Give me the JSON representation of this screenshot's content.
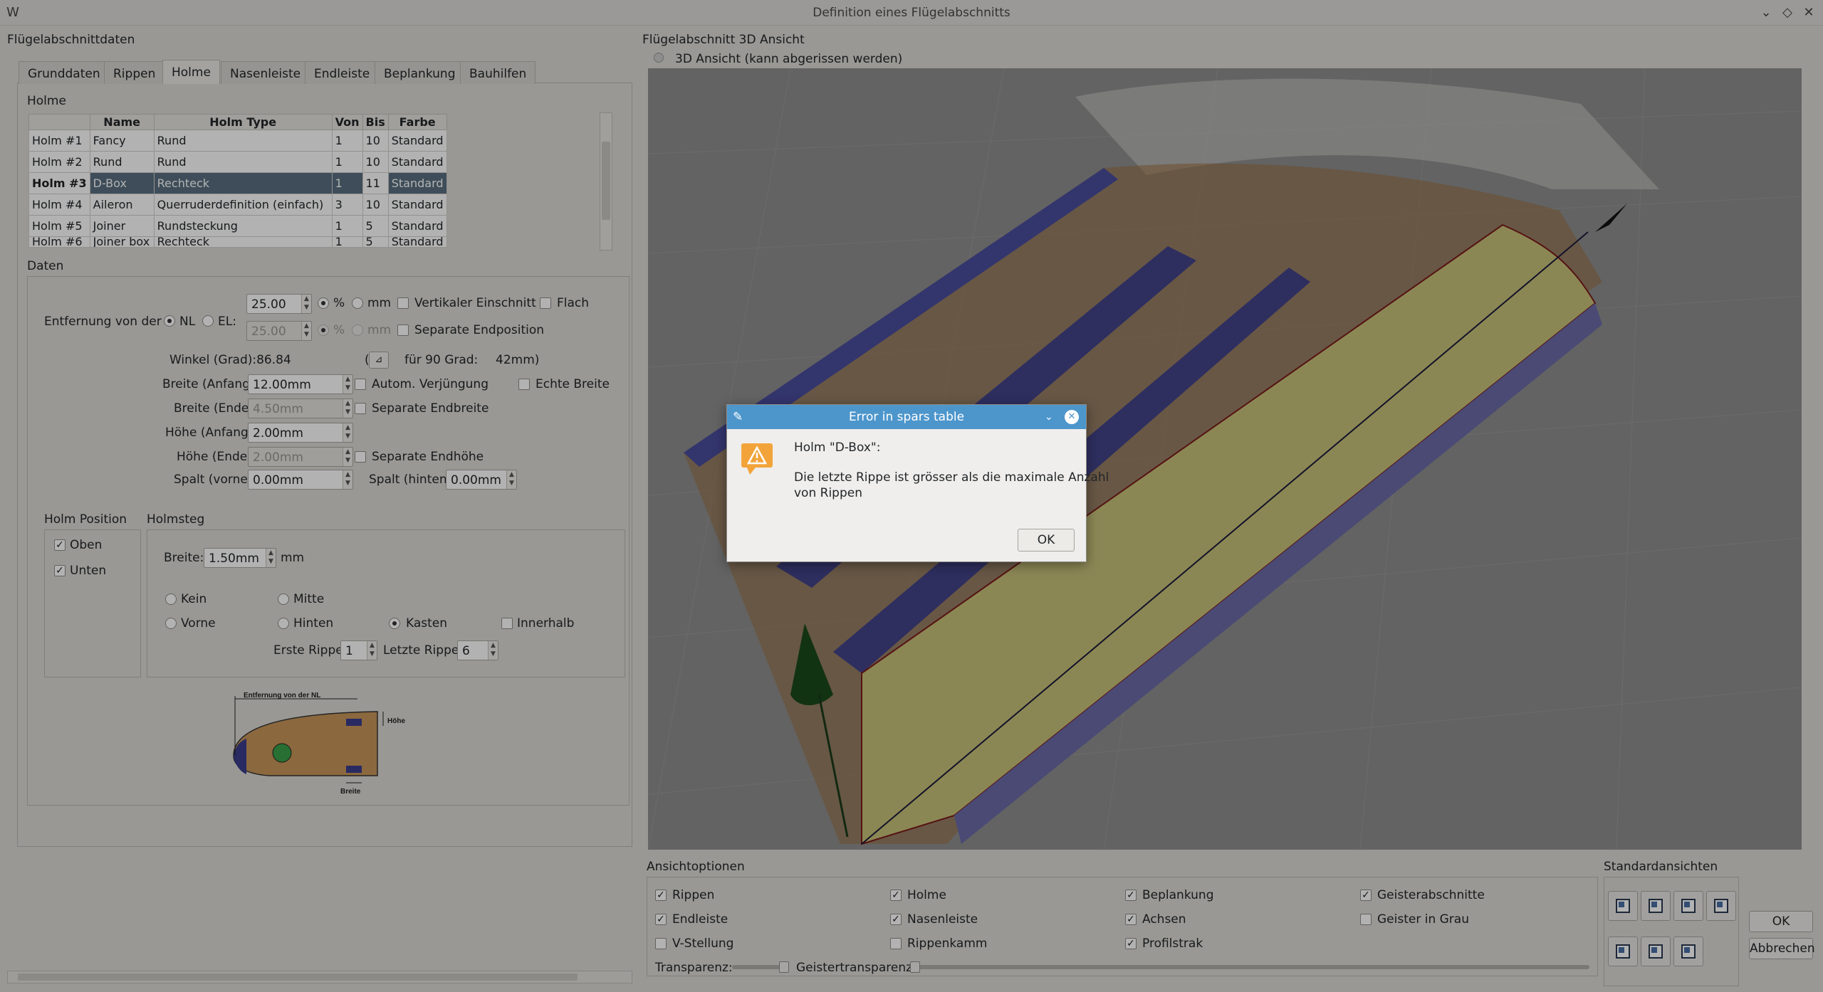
{
  "window": {
    "title": "Definition eines Flügelabschnitts"
  },
  "left_panel": {
    "title": "Flügelabschnittdaten"
  },
  "tabs": [
    {
      "label": "Grunddaten"
    },
    {
      "label": "Rippen"
    },
    {
      "label": "Holme"
    },
    {
      "label": "Nasenleiste"
    },
    {
      "label": "Endleiste"
    },
    {
      "label": "Beplankung"
    },
    {
      "label": "Bauhilfen"
    }
  ],
  "spars": {
    "group_title": "Holme",
    "columns": [
      "Name",
      "Holm Type",
      "Von",
      "Bis",
      "Farbe"
    ],
    "rows": [
      {
        "id": "Holm #1",
        "name": "Fancy",
        "type": "Rund",
        "von": "1",
        "bis": "10",
        "farbe": "Standard"
      },
      {
        "id": "Holm #2",
        "name": "Rund",
        "type": "Rund",
        "von": "1",
        "bis": "10",
        "farbe": "Standard"
      },
      {
        "id": "Holm #3",
        "name": "D-Box",
        "type": "Rechteck",
        "von": "1",
        "bis": "11",
        "farbe": "Standard"
      },
      {
        "id": "Holm #4",
        "name": "Aileron",
        "type": "Querruderdefinition (einfach)",
        "von": "3",
        "bis": "10",
        "farbe": "Standard"
      },
      {
        "id": "Holm #5",
        "name": "Joiner",
        "type": "Rundsteckung",
        "von": "1",
        "bis": "5",
        "farbe": "Standard"
      },
      {
        "id": "Holm #6",
        "name": "Joiner box",
        "type": "Rechteck",
        "von": "1",
        "bis": "5",
        "farbe": "Standard"
      }
    ]
  },
  "daten": {
    "group_title": "Daten",
    "entfernung_label": "Entfernung von der",
    "nl_label": "NL",
    "el_label": "EL:",
    "nl_value": "25.00",
    "el_value": "25.00",
    "percent": "%",
    "mm": "mm",
    "vertikaler_einschnitt": "Vertikaler Einschnitt",
    "flach": "Flach",
    "separate_endposition": "Separate Endposition",
    "winkel": "Winkel (Grad):86.84",
    "fuer_90": "für 90 Grad:",
    "fuer_90_value": "42mm)",
    "paren_open": "(",
    "breite_anfang_label": "Breite (Anfang):",
    "breite_anfang": "12.00mm",
    "autom_verjuengung": "Autom. Verjüngung",
    "echte_breite": "Echte Breite",
    "breite_ende_label": "Breite (Ende):",
    "breite_ende": "4.50mm",
    "separate_endbreite": "Separate Endbreite",
    "hoehe_anfang_label": "Höhe (Anfang):",
    "hoehe_anfang": "2.00mm",
    "hoehe_ende_label": "Höhe (Ende):",
    "hoehe_ende": "2.00mm",
    "separate_endhoehe": "Separate Endhöhe",
    "spalt_vorne_label": "Spalt (vorne):",
    "spalt_vorne": "0.00mm",
    "spalt_hinten_label": "Spalt (hinten):",
    "spalt_hinten": "0.00mm"
  },
  "holm_position": {
    "title": "Holm Position",
    "oben": "Oben",
    "unten": "Unten"
  },
  "holmsteg": {
    "title": "Holmsteg",
    "breite_label": "Breite:",
    "breite_value": "1.50mm",
    "unit": "mm",
    "kein": "Kein",
    "mitte": "Mitte",
    "vorne": "Vorne",
    "hinten": "Hinten",
    "kasten": "Kasten",
    "innerhalb": "Innerhalb",
    "erste_rippe_label": "Erste Rippe:",
    "erste_rippe": "1",
    "letzte_rippe_label": "Letzte Rippe:",
    "letzte_rippe": "6"
  },
  "diagram": {
    "top_label": "Entfernung von der NL",
    "hoehe": "Höhe",
    "breite": "Breite"
  },
  "right_panel": {
    "title": "Flügelabschnitt 3D Ansicht",
    "subtitle": "3D Ansicht (kann abgerissen werden)"
  },
  "ansicht": {
    "title": "Ansichtoptionen",
    "rippen": "Rippen",
    "holme": "Holme",
    "beplankung": "Beplankung",
    "geisterabschnitte": "Geisterabschnitte",
    "endleiste": "Endleiste",
    "nasenleiste": "Nasenleiste",
    "achsen": "Achsen",
    "geister_grau": "Geister in Grau",
    "v_stellung": "V-Stellung",
    "rippenkamm": "Rippenkamm",
    "profilstrak": "Profilstrak",
    "transparenz": "Transparenz:",
    "geistertransparenz": "Geistertransparenz:"
  },
  "standardansichten": {
    "title": "Standardansichten"
  },
  "buttons": {
    "ok": "OK",
    "abbrechen": "Abbrechen"
  },
  "dialog": {
    "title": "Error in spars table",
    "line1": "Holm \"D-Box\":",
    "line2": "Die letzte Rippe ist grösser als die maximale Anzahl",
    "line3": "von Rippen",
    "ok": "OK"
  },
  "colors": {
    "accent": "#4d96cc",
    "selection": "#5a6f80",
    "wing_top": "#c8c27a",
    "spar": "#3a3d8c",
    "rib": "#9a6a3a"
  }
}
